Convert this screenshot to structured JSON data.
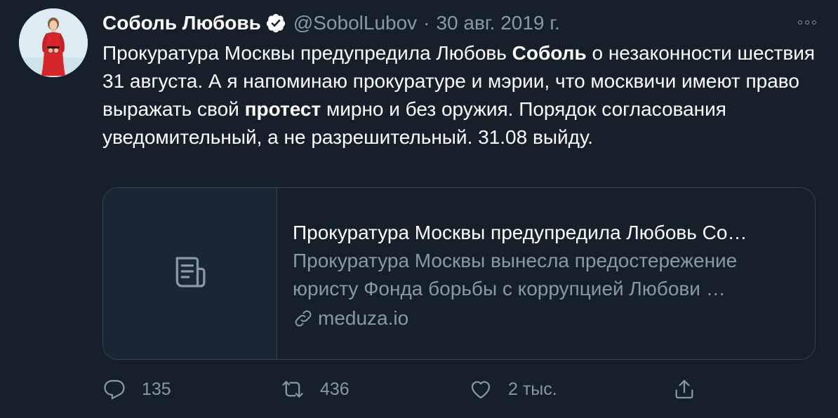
{
  "tweet": {
    "author": {
      "display_name": "Соболь Любовь",
      "handle": "@SobolLubov",
      "verified": true
    },
    "separator": "·",
    "date": "30 авг. 2019 г.",
    "text": {
      "part1": "Прокуратура Москвы предупредила Любовь ",
      "bold1": "Соболь",
      "part2": " о незаконности шествия 31 августа. А я напоминаю прокуратуре и мэрии, что москвичи имеют право выражать свой ",
      "bold2": "протест",
      "part3": " мирно и без оружия. Порядок согласования уведомительный, а не разрешительный. 31.08 выйду."
    },
    "card": {
      "title": "Прокуратура Москвы предупредила Любовь Со…",
      "description": "Прокуратура Москвы вынесла предостережение юристу Фонда борьбы с коррупцией Любови …",
      "domain": "meduza.io",
      "thumbnail_icon": "document-icon"
    },
    "actions": {
      "reply_count": "135",
      "retweet_count": "436",
      "like_count": "2 тыс."
    }
  },
  "colors": {
    "background": "#15202b",
    "text_primary": "#ffffff",
    "text_secondary": "#8899a6",
    "border": "#38444d",
    "card_thumb_bg": "#192734",
    "avatar_dress": "#d4262b"
  }
}
